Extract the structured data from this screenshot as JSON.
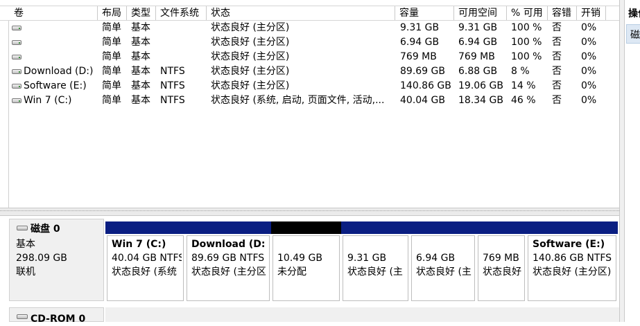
{
  "columns": [
    "卷",
    "布局",
    "类型",
    "文件系统",
    "状态",
    "容量",
    "可用空间",
    "% 可用",
    "容错",
    "开销"
  ],
  "volumes": [
    {
      "name": "",
      "layout": "简单",
      "type": "基本",
      "fs": "",
      "status": "状态良好 (主分区)",
      "capacity": "9.31 GB",
      "free": "9.31 GB",
      "pct": "100 %",
      "ft": "否",
      "overhead": "0%"
    },
    {
      "name": "",
      "layout": "简单",
      "type": "基本",
      "fs": "",
      "status": "状态良好 (主分区)",
      "capacity": "6.94 GB",
      "free": "6.94 GB",
      "pct": "100 %",
      "ft": "否",
      "overhead": "0%"
    },
    {
      "name": "",
      "layout": "简单",
      "type": "基本",
      "fs": "",
      "status": "状态良好 (主分区)",
      "capacity": "769 MB",
      "free": "769 MB",
      "pct": "100 %",
      "ft": "否",
      "overhead": "0%"
    },
    {
      "name": "Download (D:)",
      "layout": "简单",
      "type": "基本",
      "fs": "NTFS",
      "status": "状态良好 (主分区)",
      "capacity": "89.69 GB",
      "free": "6.88 GB",
      "pct": "8 %",
      "ft": "否",
      "overhead": "0%"
    },
    {
      "name": "Software (E:)",
      "layout": "简单",
      "type": "基本",
      "fs": "NTFS",
      "status": "状态良好 (主分区)",
      "capacity": "140.86 GB",
      "free": "19.06 GB",
      "pct": "14 %",
      "ft": "否",
      "overhead": "0%"
    },
    {
      "name": "Win 7 (C:)",
      "layout": "简单",
      "type": "基本",
      "fs": "NTFS",
      "status": "状态良好 (系统, 启动, 页面文件, 活动,...",
      "capacity": "40.04 GB",
      "free": "18.34 GB",
      "pct": "46 %",
      "ft": "否",
      "overhead": "0%"
    }
  ],
  "disk0": {
    "name": "磁盘 0",
    "type": "基本",
    "size": "298.09 GB",
    "state": "联机"
  },
  "partitions": [
    {
      "title": "Win 7  (C:)",
      "size": "40.04 GB NTFS",
      "status": "状态良好 (系统",
      "unallocated": false
    },
    {
      "title": "Download  (D:",
      "size": "89.69 GB NTFS",
      "status": "状态良好 (主分区",
      "unallocated": false
    },
    {
      "title": "",
      "size": "10.49 GB",
      "status": "未分配",
      "unallocated": true
    },
    {
      "title": "",
      "size": "9.31 GB",
      "status": "状态良好 (主",
      "unallocated": false
    },
    {
      "title": "",
      "size": "6.94 GB",
      "status": "状态良好 (主",
      "unallocated": false
    },
    {
      "title": "",
      "size": "769 MB",
      "status": "状态良好",
      "unallocated": false
    },
    {
      "title": "Software  (E:)",
      "size": "140.86 GB NTFS",
      "status": "状态良好 (主分区)",
      "unallocated": false
    }
  ],
  "cdrom": {
    "name": "CD-ROM 0"
  },
  "actions": {
    "title": "操作",
    "item": "磁盘"
  },
  "colors": {
    "primary_partition": "#0a1e82",
    "unallocated": "#000000"
  }
}
